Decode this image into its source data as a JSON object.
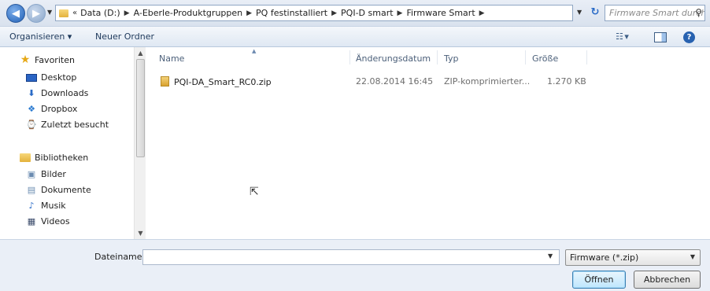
{
  "address": {
    "prefix": "«",
    "crumbs": [
      "Data (D:)",
      "A-Eberle-Produktgruppen",
      "PQ festinstalliert",
      "PQI-D smart",
      "Firmware Smart"
    ],
    "search_placeholder": "Firmware Smart durchs..."
  },
  "toolbar": {
    "organize_label": "Organisieren ▾",
    "new_folder_label": "Neuer Ordner",
    "views_label": "☷ ▾",
    "help_label": "?"
  },
  "nav": {
    "favorites_label": "Favoriten",
    "favorites": [
      "Desktop",
      "Downloads",
      "Dropbox",
      "Zuletzt besucht"
    ],
    "libraries_label": "Bibliotheken",
    "libraries": [
      "Bilder",
      "Dokumente",
      "Musik",
      "Videos"
    ]
  },
  "columns": {
    "name": "Name",
    "date": "Änderungsdatum",
    "type": "Typ",
    "size": "Größe"
  },
  "files": [
    {
      "name": "PQI-DA_Smart_RC0.zip",
      "date": "22.08.2014 16:45",
      "type": "ZIP-komprimierter...",
      "size": "1.270 KB"
    }
  ],
  "bottom": {
    "filename_label": "Dateiname:",
    "filename_value": "",
    "filter_value": "Firmware (*.zip)",
    "open_label": "Öffnen",
    "cancel_label": "Abbrechen"
  }
}
